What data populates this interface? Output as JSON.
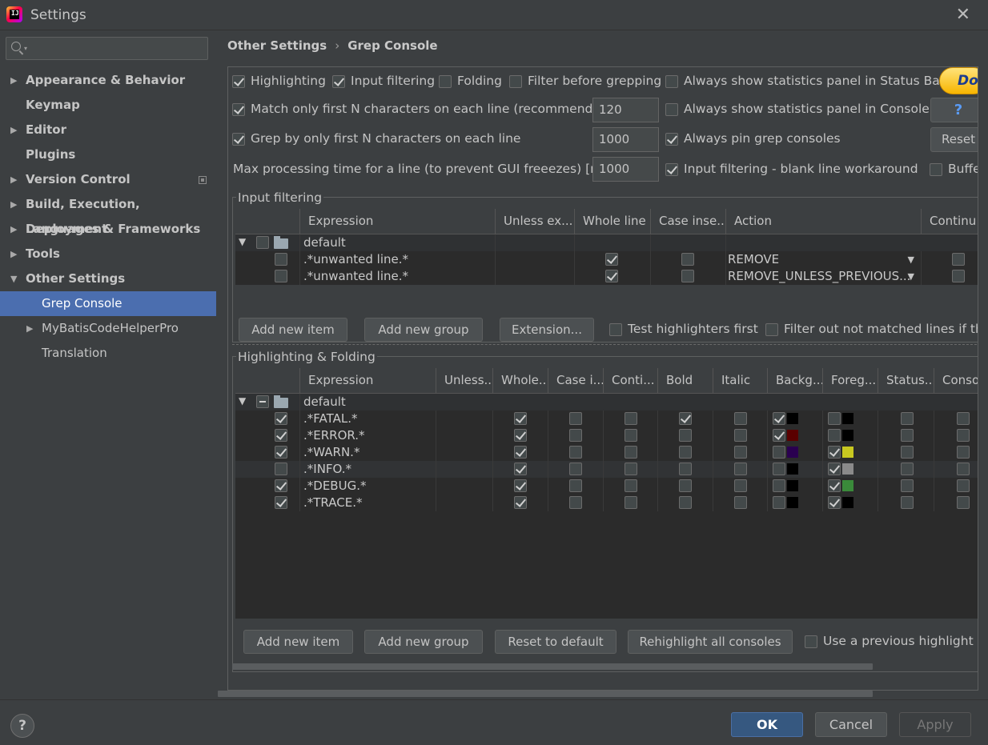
{
  "window": {
    "title": "Settings"
  },
  "sidebar": {
    "search_placeholder": "",
    "items": [
      {
        "label": "Appearance & Behavior",
        "arrow": "▶"
      },
      {
        "label": "Keymap",
        "arrow": ""
      },
      {
        "label": "Editor",
        "arrow": "▶"
      },
      {
        "label": "Plugins",
        "arrow": ""
      },
      {
        "label": "Version Control",
        "arrow": "▶"
      },
      {
        "label": "Build, Execution, Deployment",
        "arrow": "▶"
      },
      {
        "label": "Languages & Frameworks",
        "arrow": "▶"
      },
      {
        "label": "Tools",
        "arrow": "▶"
      },
      {
        "label": "Other Settings",
        "arrow": "▼"
      },
      {
        "label": "Grep Console",
        "arrow": ""
      },
      {
        "label": "MyBatisCodeHelperPro",
        "arrow": "▶"
      },
      {
        "label": "Translation",
        "arrow": ""
      }
    ]
  },
  "breadcrumb": {
    "parent": "Other Settings",
    "sep": "›",
    "current": "Grep Console"
  },
  "options": {
    "highlighting": "Highlighting",
    "input_filtering": "Input filtering",
    "folding": "Folding",
    "filter_before_grepping": "Filter before grepping",
    "always_show_stats_status": "Always show statistics panel in Status Bar",
    "match_first_n": "Match only first N characters on each line (recommended)",
    "match_first_n_value": "120",
    "always_show_stats_console": "Always show statistics panel in Console",
    "grep_first_n": "Grep by only first N characters on each line",
    "grep_first_n_value": "1000",
    "always_pin": "Always pin grep consoles",
    "max_processing": "Max processing time for a line (to prevent GUI freeezes) [ms]",
    "max_processing_value": "1000",
    "blank_line_workaround": "Input filtering - blank line workaround",
    "buffer": "Buffe",
    "donate": "Do",
    "help": "?",
    "reset": "Reset"
  },
  "input_filtering": {
    "title": "Input filtering",
    "headers": [
      "Expression",
      "Unless ex...",
      "Whole line",
      "Case inse...",
      "Action",
      "Continu"
    ],
    "group_name": "default",
    "rows": [
      {
        "expression": ".*unwanted line.*",
        "action": "REMOVE"
      },
      {
        "expression": ".*unwanted line.*",
        "action": "REMOVE_UNLESS_PREVIOUS..."
      }
    ],
    "buttons": {
      "add_item": "Add new item",
      "add_group": "Add new group",
      "extension": "Extension...",
      "test_highlighters": "Test highlighters first",
      "filter_out": "Filter out not matched lines if the"
    }
  },
  "highlighting": {
    "title": "Highlighting & Folding",
    "headers": [
      "Expression",
      "Unless...",
      "Whole...",
      "Case i...",
      "Conti...",
      "Bold",
      "Italic",
      "Backg...",
      "Foreg...",
      "Status...",
      "Conso"
    ],
    "group_name": "default",
    "rows": [
      {
        "expression": ".*FATAL.*",
        "enabled": true,
        "whole": true,
        "bold": true,
        "bg_on": true,
        "bg": "#000000",
        "fg_on": false,
        "fg": "#000000"
      },
      {
        "expression": ".*ERROR.*",
        "enabled": true,
        "whole": true,
        "bold": false,
        "bg_on": true,
        "bg": "#5a0000",
        "fg_on": false,
        "fg": "#000000"
      },
      {
        "expression": ".*WARN.*",
        "enabled": true,
        "whole": true,
        "bold": false,
        "bg_on": false,
        "bg": "#2a0050",
        "fg_on": true,
        "fg": "#c8c820"
      },
      {
        "expression": ".*INFO.*",
        "enabled": false,
        "whole": true,
        "bold": false,
        "bg_on": false,
        "bg": "#000000",
        "fg_on": true,
        "fg": "#8a8a8a"
      },
      {
        "expression": ".*DEBUG.*",
        "enabled": true,
        "whole": true,
        "bold": false,
        "bg_on": false,
        "bg": "#000000",
        "fg_on": true,
        "fg": "#3a8a3a"
      },
      {
        "expression": ".*TRACE.*",
        "enabled": true,
        "whole": true,
        "bold": false,
        "bg_on": false,
        "bg": "#000000",
        "fg_on": true,
        "fg": "#000000"
      }
    ],
    "buttons": {
      "add_item": "Add new item",
      "add_group": "Add new group",
      "reset_default": "Reset to default",
      "rehighlight": "Rehighlight all consoles",
      "use_previous": "Use a previous highlight if"
    }
  },
  "footer": {
    "help": "?",
    "ok": "OK",
    "cancel": "Cancel",
    "apply": "Apply"
  }
}
